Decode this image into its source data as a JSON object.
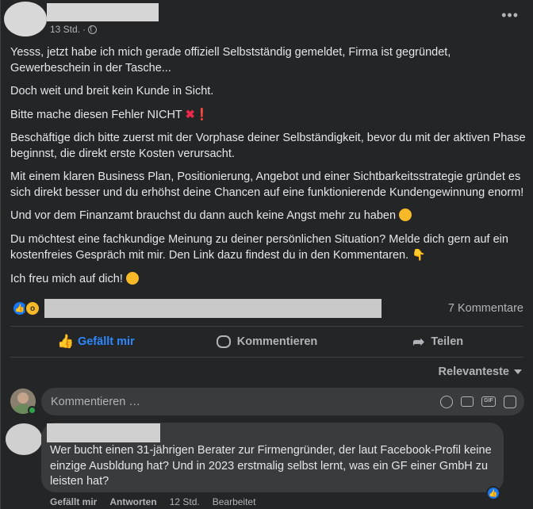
{
  "post": {
    "time": "13 Std.",
    "more_label": "•••",
    "paragraphs": {
      "p1": "Yesss, jetzt habe ich mich gerade offiziell Selbstständig gemeldet, Firma ist gegründet, Gewerbeschein in der Tasche...",
      "p2": "Doch weit und breit kein Kunde in Sicht.",
      "p3": "Bitte mache diesen Fehler NICHT",
      "p3_emoji_x": "✖",
      "p3_emoji_bang": "❗",
      "p4": "Beschäftige dich bitte zuerst mit der Vorphase deiner Selbständigkeit, bevor du mit der aktiven Phase beginnst, die direkt erste Kosten verursacht.",
      "p5": "Mit einem klaren Business Plan, Positionierung, Angebot und einer Sichtbarkeitsstrategie gründet es sich direkt besser und du erhöhst deine Chancen auf eine funktionierende Kundengewinnung enorm!",
      "p6": "Und vor dem Finanzamt brauchst du dann auch keine Angst mehr zu haben",
      "p7": "Du möchtest eine fachkundige Meinung zu deiner persönlichen Situation? Melde dich gern auf ein kostenfreies Gespräch mit mir. Den Link dazu findest du in den Kommentaren.",
      "p7_emoji": "👇",
      "p8": "Ich freu mich auf dich!"
    },
    "comment_count": "7 Kommentare",
    "reaction_icons": [
      "like-reaction",
      "wow-reaction"
    ]
  },
  "actions": {
    "like": "Gefällt mir",
    "comment": "Kommentieren",
    "share": "Teilen"
  },
  "sort_label": "Relevanteste",
  "comment_input": {
    "placeholder": "Kommentieren …",
    "icons": [
      "emoji-icon",
      "camera-icon",
      "gif-icon",
      "sticker-icon"
    ]
  },
  "comments": [
    {
      "text": "Wer bucht einen 31-jährigen Berater zur Firmengründer, der laut Facebook-Profil keine einzige Ausbldung hat? Und in 2023 erstmalig selbst lernt, was ein GF einer GmbH zu leisten hat?",
      "like_label": "Gefällt mir",
      "reply_label": "Antworten",
      "time": "12 Std.",
      "edited": "Bearbeitet"
    }
  ],
  "colors": {
    "background": "#242526",
    "accent": "#2d88ff",
    "text": "#e4e6eb",
    "muted": "#b0b3b8",
    "bubble": "#3a3b3c"
  }
}
